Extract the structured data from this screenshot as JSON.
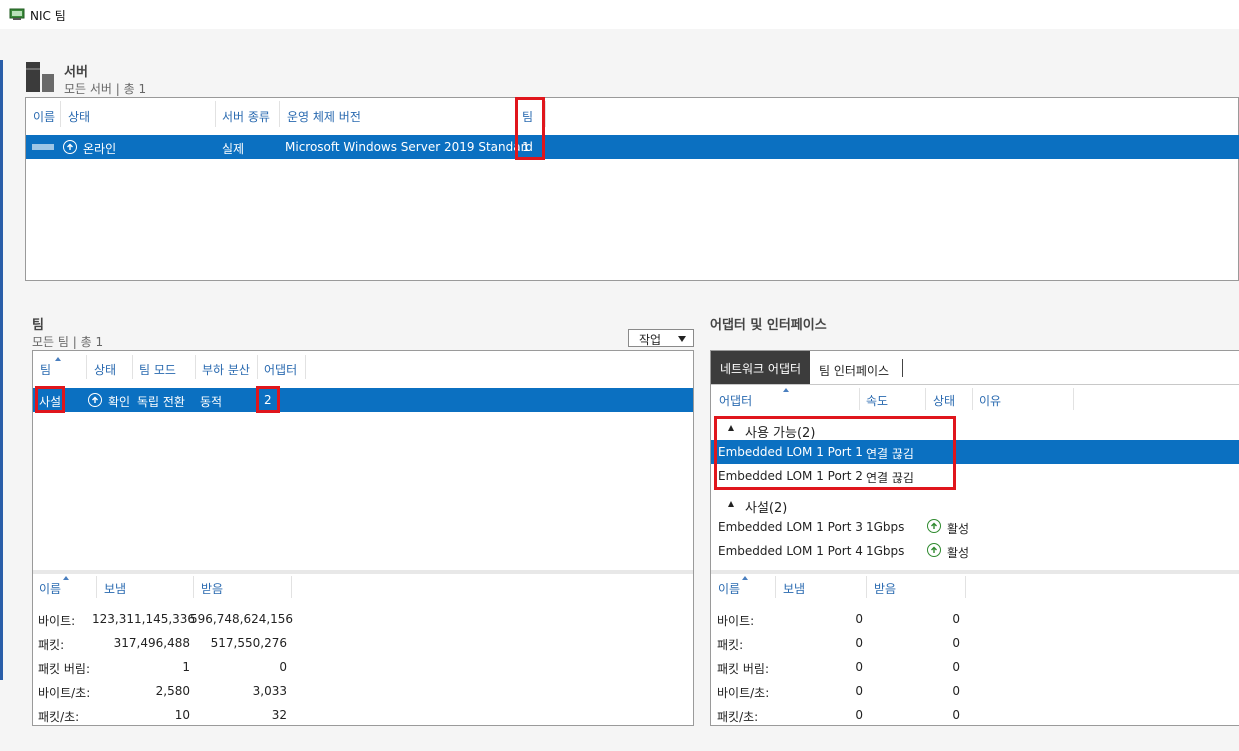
{
  "window": {
    "title": "NIC 팀"
  },
  "servers": {
    "title": "서버",
    "subtitle": "모든 서버 | 총 1",
    "columns": [
      "이름",
      "상태",
      "서버 종류",
      "운영 체제 버전",
      "팀"
    ],
    "row": {
      "status": "온라인",
      "type": "실제",
      "os": "Microsoft Windows Server 2019 Standard",
      "teams": "1"
    }
  },
  "teams": {
    "title": "팀",
    "subtitle": "모든 팀 | 총 1",
    "action_label": "작업",
    "columns": [
      "팀",
      "상태",
      "팀 모드",
      "부하 분산",
      "어댑터"
    ],
    "row": {
      "name": "사설",
      "status": "확인",
      "mode": "독립 전환",
      "lb": "동적",
      "adapters": "2"
    },
    "stats": {
      "columns": [
        "이름",
        "보냄",
        "받음"
      ],
      "rows": [
        {
          "label": "바이트:",
          "sent": "123,311,145,336",
          "recv": "596,748,624,156"
        },
        {
          "label": "패킷:",
          "sent": "317,496,488",
          "recv": "517,550,276"
        },
        {
          "label": "패킷 버림:",
          "sent": "1",
          "recv": "0"
        },
        {
          "label": "바이트/초:",
          "sent": "2,580",
          "recv": "3,033"
        },
        {
          "label": "패킷/초:",
          "sent": "10",
          "recv": "32"
        }
      ]
    }
  },
  "adapters": {
    "title": "어댑터 및 인터페이스",
    "tabs": [
      "네트워크 어댑터",
      "팀 인터페이스"
    ],
    "columns": [
      "어댑터",
      "속도",
      "상태",
      "이유"
    ],
    "group_available": "사용 가능(2)",
    "available": [
      {
        "name": "Embedded LOM 1 Port 1",
        "speed": "연결 끊김"
      },
      {
        "name": "Embedded LOM 1 Port 2",
        "speed": "연결 끊김"
      }
    ],
    "group_private": "사설(2)",
    "private": [
      {
        "name": "Embedded LOM 1 Port 3",
        "speed": "1Gbps",
        "status": "활성"
      },
      {
        "name": "Embedded LOM 1 Port 4",
        "speed": "1Gbps",
        "status": "활성"
      }
    ],
    "stats": {
      "columns": [
        "이름",
        "보냄",
        "받음"
      ],
      "rows": [
        {
          "label": "바이트:",
          "sent": "0",
          "recv": "0"
        },
        {
          "label": "패킷:",
          "sent": "0",
          "recv": "0"
        },
        {
          "label": "패킷 버림:",
          "sent": "0",
          "recv": "0"
        },
        {
          "label": "바이트/초:",
          "sent": "0",
          "recv": "0"
        },
        {
          "label": "패킷/초:",
          "sent": "0",
          "recv": "0"
        }
      ]
    }
  },
  "colors": {
    "accent": "#0b70c1",
    "highlight": "#e0161c",
    "header_text": "#2a6ab0",
    "status_green": "#2f8a2f"
  }
}
